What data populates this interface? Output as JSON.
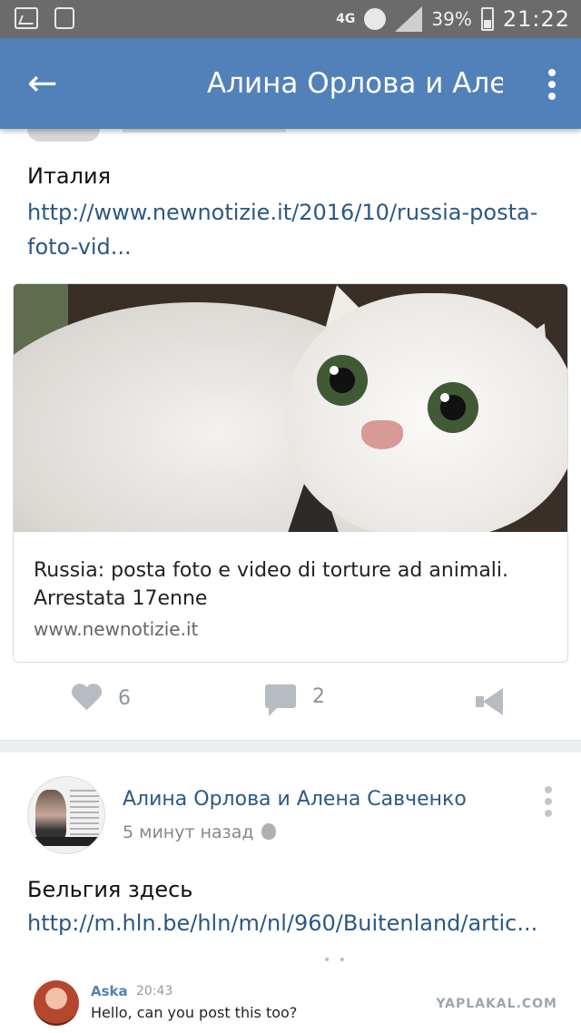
{
  "status_bar": {
    "network": "4G",
    "battery": "39%",
    "time": "21:22"
  },
  "app_bar": {
    "title": "Алина Орлова и Алена Савченко"
  },
  "post1": {
    "text": "Италия",
    "link": "http://www.newnotizie.it/2016/10/russia-posta-foto-vid...",
    "card": {
      "title": "Russia: posta foto e video di torture ad animali. Arrestata 17enne",
      "domain": "www.newnotizie.it"
    },
    "likes": "6",
    "comments": "2"
  },
  "post2": {
    "author": "Алина Орлова и Алена Савченко",
    "time": "5 минут назад",
    "text": "Бельгия здесь",
    "link": "http://m.hln.be/hln/m/nl/960/Buitenland/artic..."
  },
  "reply": {
    "name": "Aska",
    "time": "20:43",
    "text": "Hello, can you post this too?"
  },
  "watermark": "YAPLAKAL.COM",
  "icons": {
    "back": "arrow-left-icon",
    "menu": "more-vertical-icon",
    "like": "heart-icon",
    "comment": "comment-bubble-icon",
    "share": "megaphone-icon",
    "platform": "apple-icon"
  },
  "colors": {
    "app_bar": "#5181b8",
    "link": "#2a5885",
    "status_bar": "#6b6b6b"
  }
}
